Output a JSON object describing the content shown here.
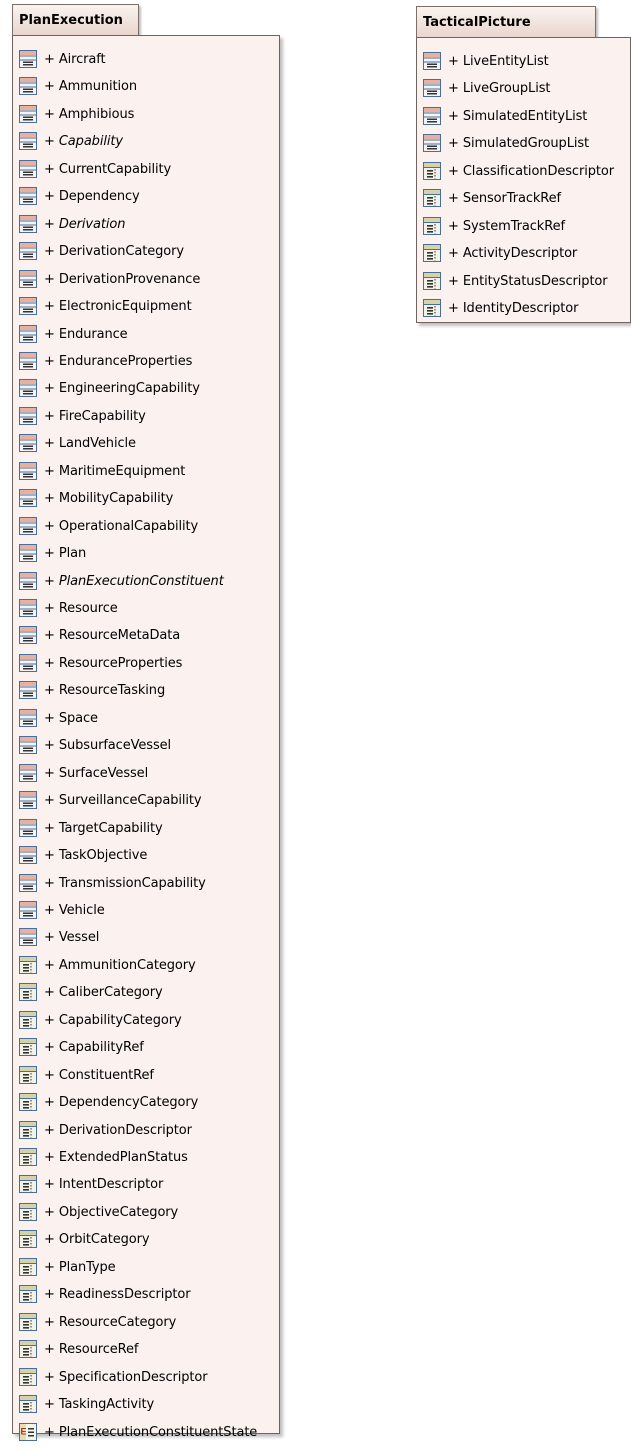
{
  "packages": [
    {
      "id": "plan-execution",
      "title": "PlanExecution",
      "items": [
        {
          "label": "+ Aircraft",
          "icon": "class-icon",
          "italic": false
        },
        {
          "label": "+ Ammunition",
          "icon": "class-icon",
          "italic": false
        },
        {
          "label": "+ Amphibious",
          "icon": "class-icon",
          "italic": false
        },
        {
          "label": "+ Capability",
          "icon": "class-icon",
          "italic": true
        },
        {
          "label": "+ CurrentCapability",
          "icon": "class-icon",
          "italic": false
        },
        {
          "label": "+ Dependency",
          "icon": "class-icon",
          "italic": false
        },
        {
          "label": "+ Derivation",
          "icon": "class-icon",
          "italic": true
        },
        {
          "label": "+ DerivationCategory",
          "icon": "class-icon",
          "italic": false
        },
        {
          "label": "+ DerivationProvenance",
          "icon": "class-icon",
          "italic": false
        },
        {
          "label": "+ ElectronicEquipment",
          "icon": "class-icon",
          "italic": false
        },
        {
          "label": "+ Endurance",
          "icon": "class-icon",
          "italic": false
        },
        {
          "label": "+ EnduranceProperties",
          "icon": "class-icon",
          "italic": false
        },
        {
          "label": "+ EngineeringCapability",
          "icon": "class-icon",
          "italic": false
        },
        {
          "label": "+ FireCapability",
          "icon": "class-icon",
          "italic": false
        },
        {
          "label": "+ LandVehicle",
          "icon": "class-icon",
          "italic": false
        },
        {
          "label": "+ MaritimeEquipment",
          "icon": "class-icon",
          "italic": false
        },
        {
          "label": "+ MobilityCapability",
          "icon": "class-icon",
          "italic": false
        },
        {
          "label": "+ OperationalCapability",
          "icon": "class-icon",
          "italic": false
        },
        {
          "label": "+ Plan",
          "icon": "class-icon",
          "italic": false
        },
        {
          "label": "+ PlanExecutionConstituent",
          "icon": "class-icon",
          "italic": true
        },
        {
          "label": "+ Resource",
          "icon": "class-icon",
          "italic": false
        },
        {
          "label": "+ ResourceMetaData",
          "icon": "class-icon",
          "italic": false
        },
        {
          "label": "+ ResourceProperties",
          "icon": "class-icon",
          "italic": false
        },
        {
          "label": "+ ResourceTasking",
          "icon": "class-icon",
          "italic": false
        },
        {
          "label": "+ Space",
          "icon": "class-icon",
          "italic": false
        },
        {
          "label": "+ SubsurfaceVessel",
          "icon": "class-icon",
          "italic": false
        },
        {
          "label": "+ SurfaceVessel",
          "icon": "class-icon",
          "italic": false
        },
        {
          "label": "+ SurveillanceCapability",
          "icon": "class-icon",
          "italic": false
        },
        {
          "label": "+ TargetCapability",
          "icon": "class-icon",
          "italic": false
        },
        {
          "label": "+ TaskObjective",
          "icon": "class-icon",
          "italic": false
        },
        {
          "label": "+ TransmissionCapability",
          "icon": "class-icon",
          "italic": false
        },
        {
          "label": "+ Vehicle",
          "icon": "class-icon",
          "italic": false
        },
        {
          "label": "+ Vessel",
          "icon": "class-icon",
          "italic": false
        },
        {
          "label": "+ AmmunitionCategory",
          "icon": "datatype-icon",
          "italic": false
        },
        {
          "label": "+ CaliberCategory",
          "icon": "datatype-icon",
          "italic": false
        },
        {
          "label": "+ CapabilityCategory",
          "icon": "datatype-icon",
          "italic": false
        },
        {
          "label": "+ CapabilityRef",
          "icon": "datatype-icon",
          "italic": false
        },
        {
          "label": "+ ConstituentRef",
          "icon": "datatype-icon",
          "italic": false
        },
        {
          "label": "+ DependencyCategory",
          "icon": "datatype-icon",
          "italic": false
        },
        {
          "label": "+ DerivationDescriptor",
          "icon": "datatype-icon",
          "italic": false
        },
        {
          "label": "+ ExtendedPlanStatus",
          "icon": "datatype-icon",
          "italic": false
        },
        {
          "label": "+ IntentDescriptor",
          "icon": "datatype-icon",
          "italic": false
        },
        {
          "label": "+ ObjectiveCategory",
          "icon": "datatype-icon",
          "italic": false
        },
        {
          "label": "+ OrbitCategory",
          "icon": "datatype-icon",
          "italic": false
        },
        {
          "label": "+ PlanType",
          "icon": "datatype-icon",
          "italic": false
        },
        {
          "label": "+ ReadinessDescriptor",
          "icon": "datatype-icon",
          "italic": false
        },
        {
          "label": "+ ResourceCategory",
          "icon": "datatype-icon",
          "italic": false
        },
        {
          "label": "+ ResourceRef",
          "icon": "datatype-icon",
          "italic": false
        },
        {
          "label": "+ SpecificationDescriptor",
          "icon": "datatype-icon",
          "italic": false
        },
        {
          "label": "+ TaskingActivity",
          "icon": "datatype-icon",
          "italic": false
        },
        {
          "label": "+ PlanExecutionConstituentState",
          "icon": "enumeration-icon",
          "italic": false
        }
      ]
    },
    {
      "id": "tactical-picture",
      "title": "TacticalPicture",
      "items": [
        {
          "label": "+ LiveEntityList",
          "icon": "class-icon",
          "italic": false
        },
        {
          "label": "+ LiveGroupList",
          "icon": "class-icon",
          "italic": false
        },
        {
          "label": "+ SimulatedEntityList",
          "icon": "class-icon",
          "italic": false
        },
        {
          "label": "+ SimulatedGroupList",
          "icon": "class-icon",
          "italic": false
        },
        {
          "label": "+ ClassificationDescriptor",
          "icon": "datatype-icon",
          "italic": false
        },
        {
          "label": "+ SensorTrackRef",
          "icon": "datatype-icon",
          "italic": false
        },
        {
          "label": "+ SystemTrackRef",
          "icon": "datatype-icon",
          "italic": false
        },
        {
          "label": "+ ActivityDescriptor",
          "icon": "datatype-icon",
          "italic": false
        },
        {
          "label": "+ EntityStatusDescriptor",
          "icon": "datatype-icon",
          "italic": false
        },
        {
          "label": "+ IdentityDescriptor",
          "icon": "datatype-icon",
          "italic": false
        }
      ]
    }
  ]
}
